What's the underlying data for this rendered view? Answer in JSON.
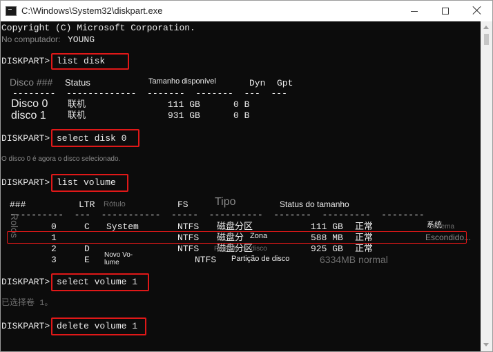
{
  "window": {
    "title": "C:\\Windows\\System32\\diskpart.exe",
    "buttons": {
      "minimize": "minimize",
      "maximize": "maximize",
      "close": "close"
    }
  },
  "console": {
    "copyright": "Copyright (C) Microsoft Corporation.",
    "computer_label": "No computador:",
    "computer_name": "YOUNG",
    "prompt": "DISKPART>",
    "commands": [
      "list disk",
      "select disk 0",
      "list volume",
      "select volume 1",
      "delete volume 1"
    ],
    "disk_table": {
      "headers": {
        "disk": "Disco ###",
        "status": "Status",
        "size": "Tamanho disponível",
        "dyn": "Dyn",
        "gpt": "Gpt"
      },
      "sep": "--------  -------------  -------  -------  ---  ---",
      "rows": [
        {
          "name": "Disco 0",
          "status": "联机",
          "size": "111 GB",
          "free": "0 B"
        },
        {
          "name": "disco 1",
          "status": "联机",
          "size": "931 GB",
          "free": "0 B"
        }
      ]
    },
    "select_disk_msg": "O disco 0 é agora o disco selecionado.",
    "volume_table": {
      "headers": {
        "num": "###",
        "ltr": "LTR",
        "label": "Rótulo",
        "fs": "FS",
        "type": "Tipo",
        "size": "Status do tamanho"
      },
      "rolos": "Rolos",
      "sep": "----------  ---  -----------  -----  ----------  -------  ---------  --------",
      "rows": [
        {
          "num": "0",
          "ltr": "C",
          "label": "System",
          "fs": "NTFS",
          "type": "磁盘分区",
          "size": "111 GB",
          "status": "正常",
          "info": "系统"
        },
        {
          "num": "1",
          "ltr": "",
          "label": "",
          "fs": "NTFS",
          "type": "磁盘分",
          "type_overlay": "Zona",
          "size": "588 MB",
          "status": "正常",
          "info": "Escondido..."
        },
        {
          "num": "2",
          "ltr": "D",
          "label": "",
          "fs": "NTFS",
          "type": "磁盘分区",
          "size": "925 GB",
          "status": "正常",
          "info": ""
        },
        {
          "num": "3",
          "ltr": "E",
          "label": "Novo Vo-\nlume",
          "fs": "NTFS",
          "type": "Partição de disco",
          "size": "6334MB normal",
          "status": "",
          "info": ""
        }
      ],
      "row1_info_prefix": "Sistema",
      "row2_type_overlay": "Partição de disco"
    },
    "after_select_volume": "已选择卷 1。"
  }
}
